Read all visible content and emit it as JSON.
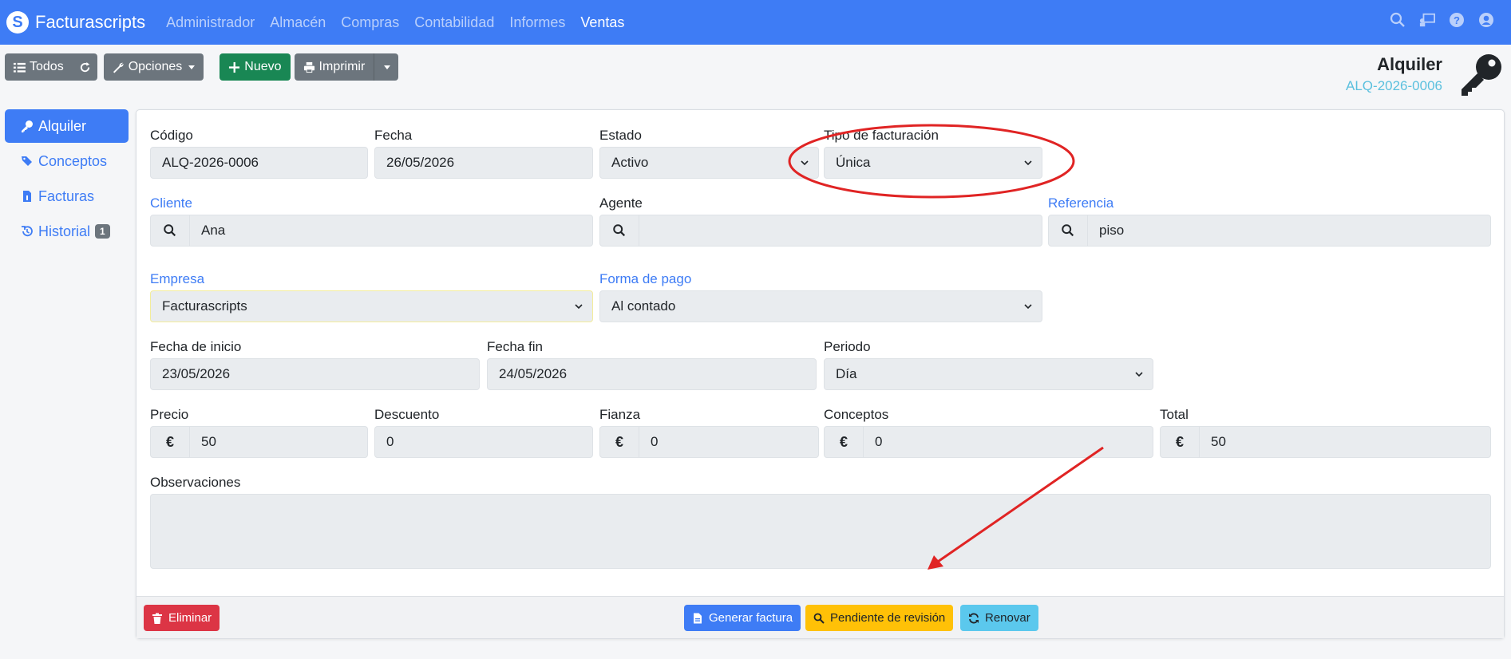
{
  "navbar": {
    "brand": "Facturascripts",
    "menu": [
      "Administrador",
      "Almacén",
      "Compras",
      "Contabilidad",
      "Informes",
      "Ventas"
    ],
    "active": "Ventas"
  },
  "toolbar": {
    "todos": "Todos",
    "opciones": "Opciones",
    "nuevo": "Nuevo",
    "imprimir": "Imprimir"
  },
  "header": {
    "title": "Alquiler",
    "code": "ALQ-2026-0006"
  },
  "sidebar": {
    "items": [
      {
        "label": "Alquiler",
        "icon": "key-icon",
        "active": true
      },
      {
        "label": "Conceptos",
        "icon": "tags-icon"
      },
      {
        "label": "Facturas",
        "icon": "file-invoice-icon"
      },
      {
        "label": "Historial",
        "icon": "history-icon",
        "badge": "1"
      }
    ]
  },
  "form": {
    "codigo": {
      "label": "Código",
      "value": "ALQ-2026-0006"
    },
    "fecha": {
      "label": "Fecha",
      "value": "26/05/2026"
    },
    "estado": {
      "label": "Estado",
      "value": "Activo"
    },
    "tipo_facturacion": {
      "label": "Tipo de facturación",
      "value": "Única"
    },
    "cliente": {
      "label": "Cliente",
      "value": "Ana"
    },
    "agente": {
      "label": "Agente",
      "value": ""
    },
    "referencia": {
      "label": "Referencia",
      "value": "piso"
    },
    "empresa": {
      "label": "Empresa",
      "value": "Facturascripts"
    },
    "forma_pago": {
      "label": "Forma de pago",
      "value": "Al contado"
    },
    "fecha_inicio": {
      "label": "Fecha de inicio",
      "value": "23/05/2026"
    },
    "fecha_fin": {
      "label": "Fecha fin",
      "value": "24/05/2026"
    },
    "periodo": {
      "label": "Periodo",
      "value": "Día"
    },
    "precio": {
      "label": "Precio",
      "value": "50"
    },
    "descuento": {
      "label": "Descuento",
      "value": "0"
    },
    "fianza": {
      "label": "Fianza",
      "value": "0"
    },
    "conceptos": {
      "label": "Conceptos",
      "value": "0"
    },
    "total": {
      "label": "Total",
      "value": "50"
    },
    "observaciones": {
      "label": "Observaciones",
      "value": ""
    },
    "currency": "€"
  },
  "footer": {
    "eliminar": "Eliminar",
    "generar_factura": "Generar factura",
    "pendiente": "Pendiente de revisión",
    "renovar": "Renovar"
  },
  "colors": {
    "primary": "#3e7cf5",
    "annotation": "#e02424"
  }
}
